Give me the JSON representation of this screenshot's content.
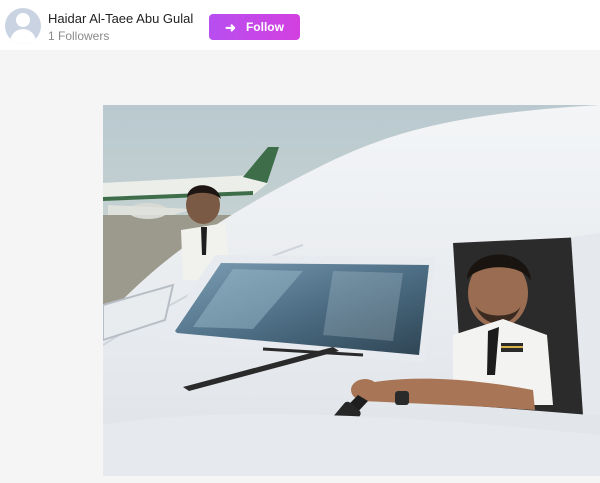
{
  "post": {
    "user_name": "Haidar Al-Taee Abu Gulal",
    "followers": "1 Followers",
    "follow_label": "Follow",
    "follow_icon": "arrow-right-icon",
    "accent_color": "#c848e8"
  },
  "photo": {
    "subject_icon": "cockpit-selfie-photo"
  }
}
